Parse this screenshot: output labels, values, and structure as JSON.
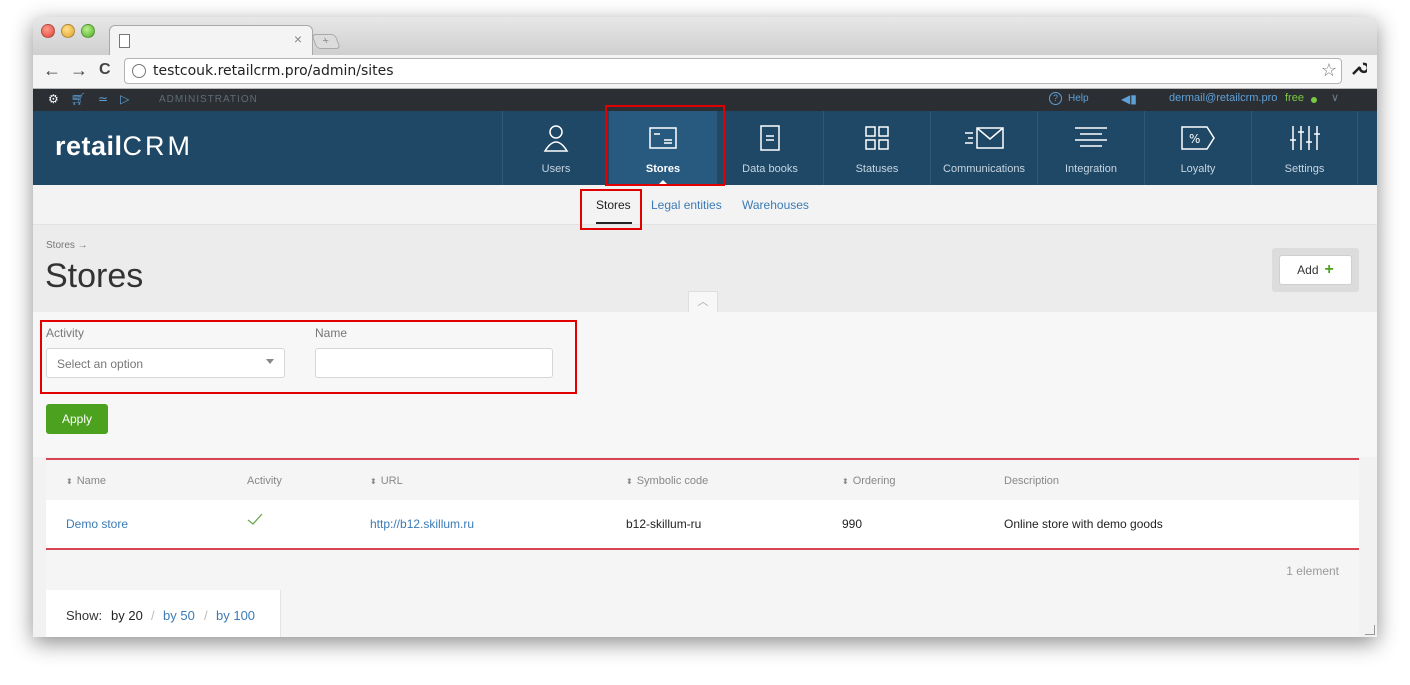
{
  "browser": {
    "url": "testcouk.retailcrm.pro/admin/sites"
  },
  "admin_bar": {
    "label": "ADMINISTRATION",
    "help": "Help",
    "email": "dermail@retailcrm.pro",
    "plan": "free"
  },
  "logo": {
    "part1": "retail",
    "part2": "CRM"
  },
  "nav": [
    {
      "label": "Users",
      "icon": "user-icon"
    },
    {
      "label": "Stores",
      "icon": "store-icon"
    },
    {
      "label": "Data books",
      "icon": "book-icon"
    },
    {
      "label": "Statuses",
      "icon": "grid-icon"
    },
    {
      "label": "Communications",
      "icon": "envelope-icon"
    },
    {
      "label": "Integration",
      "icon": "integration-icon"
    },
    {
      "label": "Loyalty",
      "icon": "percent-tag-icon"
    },
    {
      "label": "Settings",
      "icon": "sliders-icon"
    }
  ],
  "subnav": [
    "Stores",
    "Legal entities",
    "Warehouses"
  ],
  "page": {
    "breadcrumb": "Stores →",
    "title": "Stores",
    "add_label": "Add"
  },
  "filters": {
    "activity_label": "Activity",
    "activity_placeholder": "Select an option",
    "name_label": "Name",
    "name_value": "",
    "apply_label": "Apply"
  },
  "table": {
    "columns": [
      "Name",
      "Activity",
      "URL",
      "Symbolic code",
      "Ordering",
      "Description"
    ],
    "rows": [
      {
        "name": "Demo store",
        "activity": true,
        "url": "http://b12.skillum.ru",
        "code": "b12-skillum-ru",
        "ordering": "990",
        "description": "Online store with demo goods"
      }
    ],
    "count": "1 element"
  },
  "pager": {
    "show": "Show:",
    "current": "by 20",
    "options": [
      "by 50",
      "by 100"
    ]
  },
  "colors": {
    "nav_bg": "#1f4766",
    "accent_green": "#4ca11f",
    "link": "#3b7bb6",
    "annotation": "#e00000"
  }
}
